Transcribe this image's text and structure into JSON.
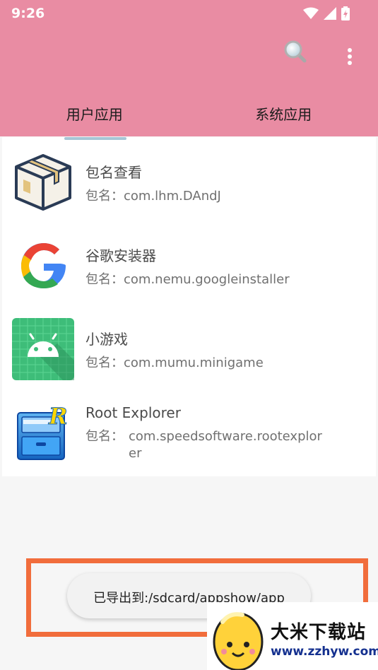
{
  "status_bar": {
    "time": "9:26"
  },
  "toolbar": {
    "search_icon": "search-icon",
    "more_icon": "more-vert-icon"
  },
  "tabs": [
    {
      "label": "用户应用",
      "selected": true
    },
    {
      "label": "系统应用",
      "selected": false
    }
  ],
  "colors": {
    "appbar": "#e98ca3",
    "indicator": "#a7c6d6",
    "highlight": "#f16d3c"
  },
  "apps": [
    {
      "name": "包名查看",
      "package_prefix": "包名：",
      "package": "com.lhm.DAndJ",
      "icon": "package-box-icon"
    },
    {
      "name": "谷歌安装器",
      "package_prefix": "包名：",
      "package": "com.nemu.googleinstaller",
      "icon": "google-icon"
    },
    {
      "name": "小游戏",
      "package_prefix": "包名：",
      "package": "com.mumu.minigame",
      "icon": "android-icon"
    },
    {
      "name": "Root Explorer",
      "package_prefix": "包名：",
      "package": "com.speedsoftware.rootexplorer",
      "icon": "root-explorer-icon"
    }
  ],
  "toast": {
    "message": "已导出到:/sdcard/appshow/app"
  },
  "watermark": {
    "title": "大米下载站",
    "url": "www.zzhyw.com"
  }
}
